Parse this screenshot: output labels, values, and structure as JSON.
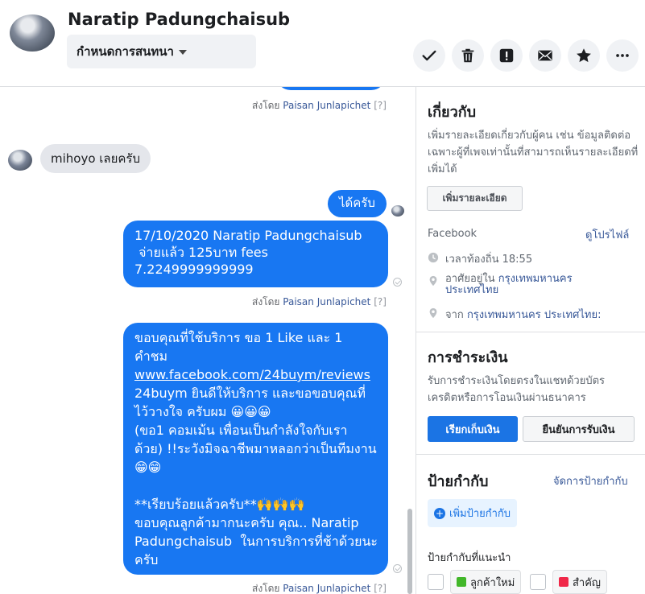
{
  "header": {
    "contact_name": "Naratip Padungchaisub",
    "assign_label": "กำหนดการสนทนา"
  },
  "messages": {
    "sent_by_prefix": "ส่งโดย",
    "sender": "Paisan Junlapichet",
    "help_mark": "[?]",
    "incoming_1": "mihoyo เลยครับ",
    "outgoing_1": "ได้ครับ",
    "outgoing_2": [
      "17/10/2020 Naratip Padungchaisub",
      " จ่ายแล้ว 125บาท fees",
      "7.2249999999999"
    ],
    "outgoing_3": {
      "line1": "ขอบคุณที่ใช้บริการ ขอ 1 Like และ 1",
      "line2": "คำชม",
      "link": "www.facebook.com/24buym/reviews",
      "line3": "24buym ยินดีให้บริการ และขอขอบคุณที่",
      "line4": "ไว้วางใจ ครับผม 😀😀😀",
      "line5": "(ขอ1 คอมเม้น เพื่อนเป็นกำลังใจกับเรา",
      "line6": "ด้วย) !!ระวังมิจฉาชีพมาหลอกว่าเป็นทีมงาน",
      "line7": "😁😁",
      "line8": "**เรียบร้อยแล้วครับ**🙌🙌🙌",
      "line9": "ขอบคุณลูกค้ามากนะครับ คุณ.. Naratip",
      "line10": "Padungchaisub  ในการบริการที่ช้าด้วยนะ",
      "line11": "ครับ"
    }
  },
  "about": {
    "title": "เกี่ยวกับ",
    "description": "เพิ่มรายละเอียดเกี่ยวกับผู้คน เช่น ข้อมูลติดต่อ เฉพาะผู้ที่เพจเท่านั้นที่สามารถเห็นรายละเอียดที่เพิ่มได้",
    "desc_lines": [
      "เพิ่มรายละเอียดเกี่ยวกับผู้คน เช่น ข้อมูลติดต่อ",
      "เฉพาะผู้ที่เพจเท่านั้นที่สามารถเห็นรายละเอียดที่",
      "เพิ่มได้"
    ],
    "add_details_button": "เพิ่มรายละเอียด",
    "source_label": "Facebook",
    "view_profile_link": "ดูโปรไฟล์",
    "local_time": "เวลาท้องถิ่น 18:55",
    "lives_in_prefix": "อาศัยอยู่ใน",
    "lives_in_city": "กรุงเทพมหานคร",
    "lives_in_country": "ประเทศไทย",
    "from_prefix": "จาก",
    "from_place": "กรุงเทพมหานคร ประเทศไทย:"
  },
  "payment": {
    "title": "การชำระเงิน",
    "desc_lines": [
      "รับการชำระเงินโดยตรงในแชทด้วยบัตร",
      "เครดิตหรือการโอนเงินผ่านธนาคาร"
    ],
    "request_button": "เรียกเก็บเงิน",
    "confirm_button": "ยืนยันการรับเงิน"
  },
  "labels": {
    "title": "ป้ายกำกับ",
    "manage_link": "จัดการป้ายกำกับ",
    "add_label_button": "เพิ่มป้ายกำกับ",
    "suggested_title": "ป้ายกำกับที่แนะนำ",
    "suggested": [
      {
        "name": "ลูกค้าใหม่",
        "color": "#42b72a"
      },
      {
        "name": "สำคัญ",
        "color": "#f02849"
      }
    ]
  },
  "colors": {
    "accent": "#1877f2",
    "incoming_bubble": "#e4e6eb"
  },
  "icons": [
    "check-icon",
    "trash-icon",
    "alert-icon",
    "mail-icon",
    "star-icon",
    "more-icon",
    "clock-icon",
    "location-icon"
  ]
}
